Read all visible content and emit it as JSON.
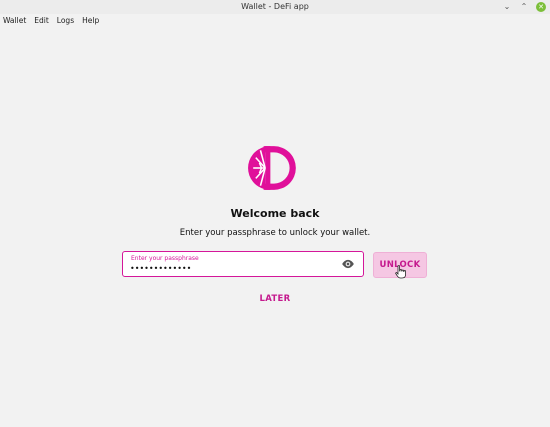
{
  "window": {
    "title": "Wallet - DeFi app"
  },
  "menubar": {
    "items": [
      {
        "label": "Wallet"
      },
      {
        "label": "Edit"
      },
      {
        "label": "Logs"
      },
      {
        "label": "Help"
      }
    ]
  },
  "unlock": {
    "heading": "Welcome back",
    "subtitle": "Enter your passphrase to unlock your wallet.",
    "passphrase": {
      "label": "Enter your passphrase",
      "value": "•••••••••••••"
    },
    "unlock_label": "UNLOCK",
    "later_label": "LATER"
  },
  "colors": {
    "accent": "#d4179a",
    "background": "#f2f2f2",
    "button_bg": "#f5c7e3"
  },
  "icons": {
    "logo": "defichain-logo-icon",
    "eye": "eye-icon",
    "cursor": "hand-pointer-icon"
  }
}
